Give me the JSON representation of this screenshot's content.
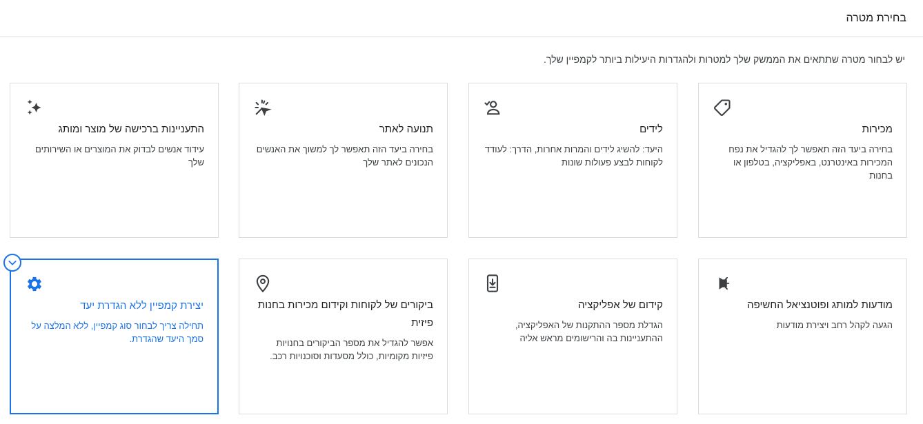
{
  "header": {
    "title": "בחירת מטרה"
  },
  "subtitle": "יש לבחור מטרה שתתאים את הממשק שלך למטרות ולהגדרות היעילות ביותר לקמפיין שלך.",
  "colors": {
    "accent": "#1a73e8",
    "border": "#dadce0",
    "text": "#202124"
  },
  "cards": [
    {
      "icon": "tag-icon",
      "title": "מכירות",
      "desc": "בחירה ביעד הזה תאפשר לך להגדיל את נפח המכירות באינטרנט, באפליקציה, בטלפון או בחנות",
      "selected": false
    },
    {
      "icon": "leads-person-icon",
      "title": "לידים",
      "desc": "היעד: להשיג לידים והמרות אחרות, הדרך: לעודד לקוחות לבצע פעולות שונות",
      "selected": false
    },
    {
      "icon": "click-sparkle-icon",
      "title": "תנועה לאתר",
      "desc": "בחירה ביעד הזה תאפשר לך למשוך את האנשים הנכונים לאתר שלך",
      "selected": false
    },
    {
      "icon": "sparkles-icon",
      "title": "התעניינות ברכישה של מוצר ומותג",
      "desc": "עידוד אנשים לבדוק את המוצרים או השירותים שלך",
      "selected": false
    },
    {
      "icon": "megaphone-icon",
      "title": "מודעות למותג ופוטנציאל החשיפה",
      "desc": "הגעה לקהל רחב ויצירת מודעות",
      "selected": false
    },
    {
      "icon": "mobile-download-icon",
      "title": "קידום של אפליקציה",
      "desc": "הגדלת מספר ההתקנות של האפליקציה, ההתעניינות בה והרישומים מראש אליה",
      "selected": false
    },
    {
      "icon": "location-pin-icon",
      "title": "ביקורים של לקוחות וקידום מכירות בחנות פיזית",
      "desc": "אפשר להגדיל את מספר הביקורים בחנויות פיזיות מקומיות, כולל מסעדות וסוכנויות רכב.",
      "selected": false
    },
    {
      "icon": "gear-icon",
      "title": "יצירת קמפיין ללא הגדרת יעד",
      "desc": "תחילה צריך לבחור סוג קמפיין, ללא המלצה על סמך היעד שהגדרת.",
      "selected": true
    }
  ]
}
